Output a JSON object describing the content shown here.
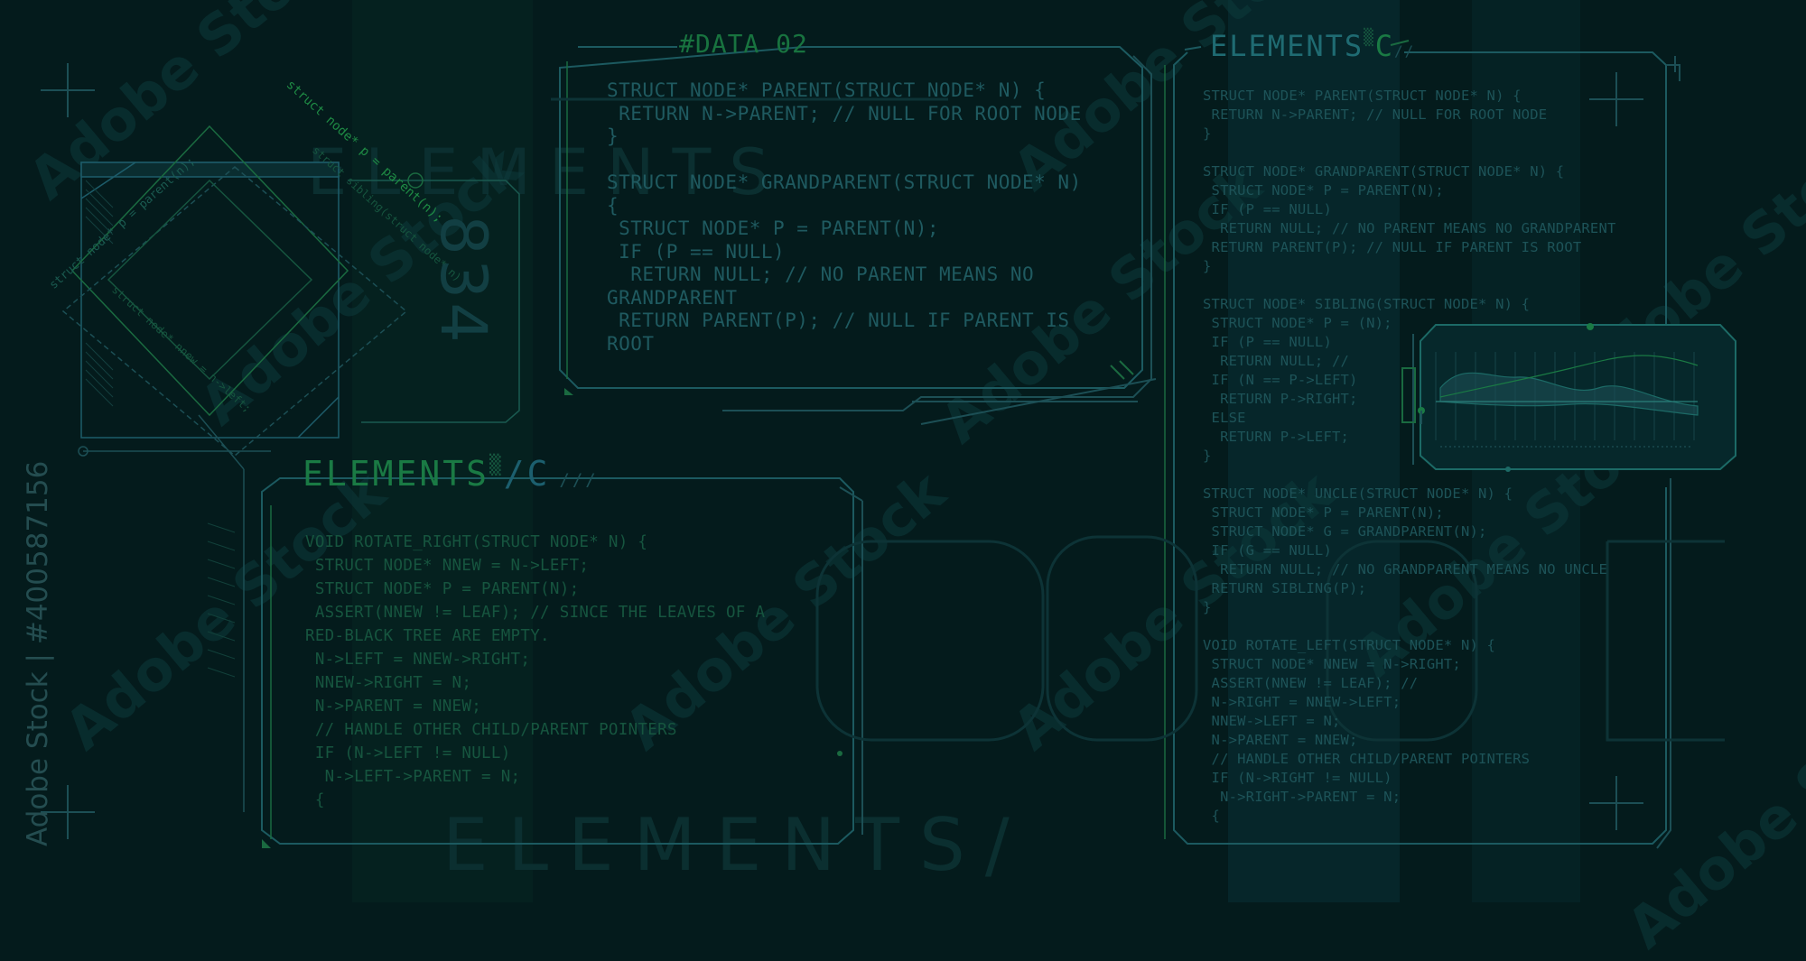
{
  "panels": {
    "data": {
      "title": "#DATA 02",
      "lines": [
        "STRUCT NODE* PARENT(STRUCT NODE* N) {",
        " RETURN N->PARENT; // NULL FOR ROOT NODE",
        "}",
        "",
        "STRUCT NODE* GRANDPARENT(STRUCT NODE* N)",
        "{",
        " STRUCT NODE* P = PARENT(N);",
        " IF (P == NULL)",
        "  RETURN NULL; // NO PARENT MEANS NO",
        "GRANDPARENT",
        " RETURN PARENT(P); // NULL IF PARENT IS",
        "ROOT"
      ]
    },
    "elements_left": {
      "title": "ELEMENTS",
      "title_suffix": "/C",
      "lines": [
        "VOID ROTATE_RIGHT(STRUCT NODE* N) {",
        " STRUCT NODE* NNEW = N->LEFT;",
        " STRUCT NODE* P = PARENT(N);",
        " ASSERT(NNEW != LEAF); // SINCE THE LEAVES OF A",
        "RED-BLACK TREE ARE EMPTY.",
        " N->LEFT = NNEW->RIGHT;",
        " NNEW->RIGHT = N;",
        " N->PARENT = NNEW;",
        " // HANDLE OTHER CHILD/PARENT POINTERS",
        " IF (N->LEFT != NULL)",
        "  N->LEFT->PARENT = N;",
        " {"
      ]
    },
    "elements_right": {
      "title": "ELEMENTS",
      "title_suffix": "C",
      "lines": [
        "STRUCT NODE* PARENT(STRUCT NODE* N) {",
        " RETURN N->PARENT; // NULL FOR ROOT NODE",
        "}",
        "",
        "STRUCT NODE* GRANDPARENT(STRUCT NODE* N) {",
        " STRUCT NODE* P = PARENT(N);",
        " IF (P == NULL)",
        "  RETURN NULL; // NO PARENT MEANS NO GRANDPARENT",
        " RETURN PARENT(P); // NULL IF PARENT IS ROOT",
        "}",
        "",
        "STRUCT NODE* SIBLING(STRUCT NODE* N) {",
        " STRUCT NODE* P = (N);",
        " IF (P == NULL)",
        "  RETURN NULL; //",
        " IF (N == P->LEFT)",
        "  RETURN P->RIGHT;",
        " ELSE",
        "  RETURN P->LEFT;",
        "}",
        "",
        "STRUCT NODE* UNCLE(STRUCT NODE* N) {",
        " STRUCT NODE* P = PARENT(N);",
        " STRUCT NODE* G = GRANDPARENT(N);",
        " IF (G == NULL)",
        "  RETURN NULL; // NO GRANDPARENT MEANS NO UNCLE",
        " RETURN SIBLING(P);",
        "}",
        "",
        "VOID ROTATE_LEFT(STRUCT NODE* N) {",
        " STRUCT NODE* NNEW = N->RIGHT;",
        " ASSERT(NNEW != LEAF); //",
        " N->RIGHT = NNEW->LEFT;",
        " NNEW->LEFT = N;",
        " N->PARENT = NNEW;",
        " // HANDLE OTHER CHILD/PARENT POINTERS",
        " IF (N->RIGHT != NULL)",
        "  N->RIGHT->PARENT = N;",
        " {"
      ]
    }
  },
  "diamond_texts": [
    "struct node* p = parent(n);",
    "struct node* p = parent(n);",
    "struct sibling(struct node* n)",
    "struct node* nnew = n->left;"
  ],
  "big_number": "834",
  "watermark": {
    "text": "Adobe Stock",
    "stock_id": "Adobe Stock | #400587156"
  },
  "colors": {
    "background": "#041b1c",
    "line_teal": "#1c4f55",
    "line_green": "#1a6a40",
    "text_code": "#1f5a60"
  }
}
